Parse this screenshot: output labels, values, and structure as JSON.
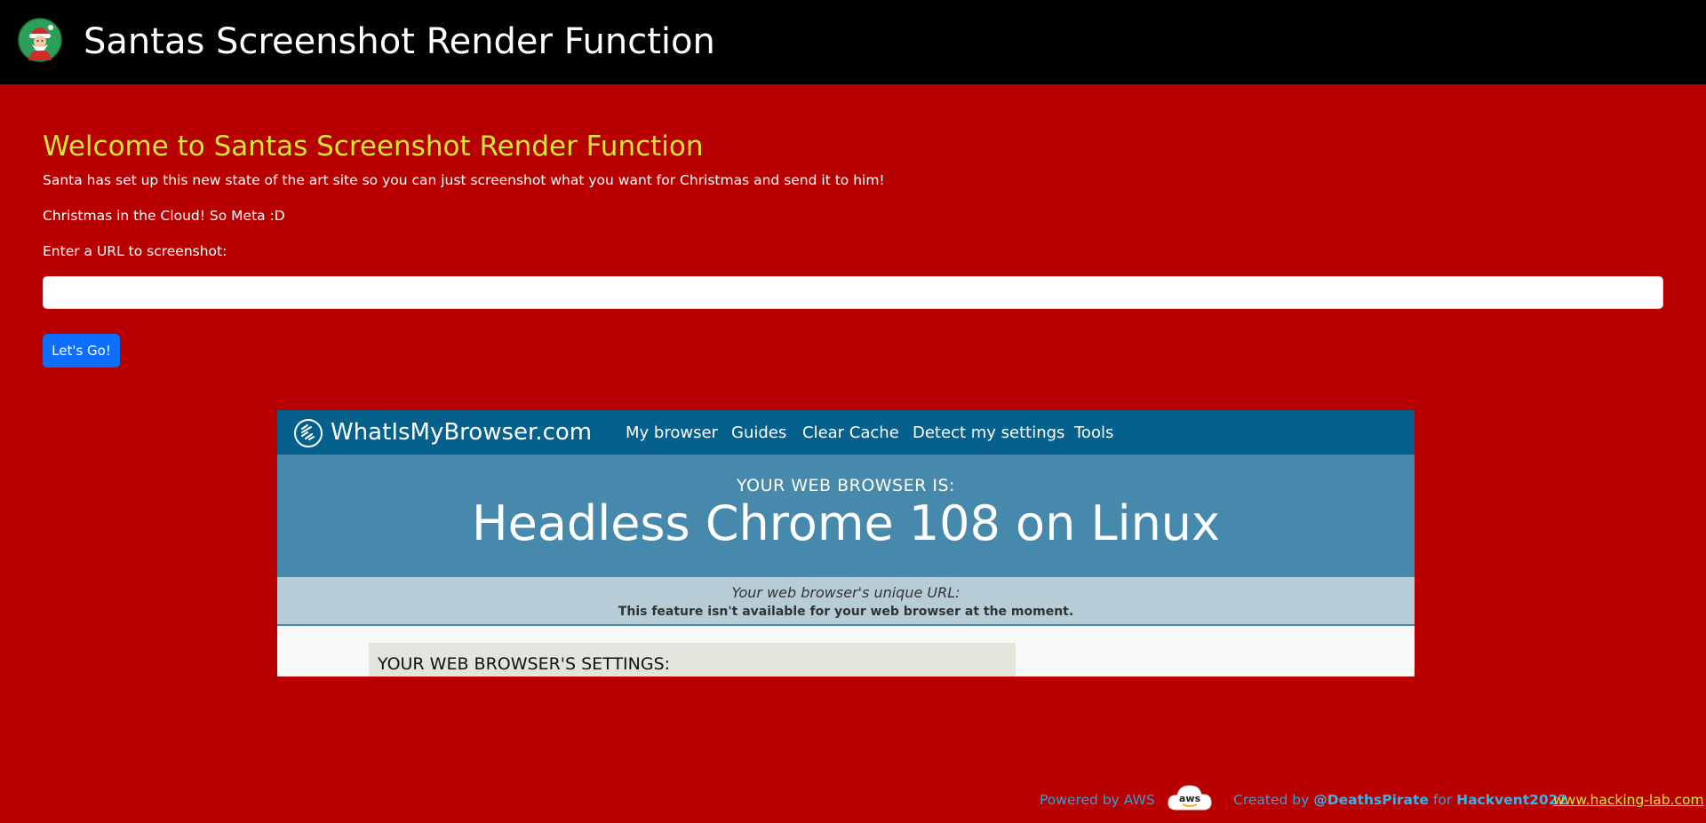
{
  "header": {
    "title": "Santas Screenshot Render Function",
    "logo_icon": "santa-avatar-icon"
  },
  "main": {
    "welcome": "Welcome to Santas Screenshot Render Function",
    "intro": "Santa has set up this new state of the art site so you can just screenshot what you want for Christmas and send it to him!",
    "tagline": "Christmas in the Cloud! So Meta :D",
    "url_prompt": "Enter a URL to screenshot:",
    "url_value": "",
    "submit_label": "Let's Go!"
  },
  "screenshot": {
    "brand": "WhatIsMyBrowser.com",
    "menu": [
      "My browser",
      "Guides",
      "Clear Cache",
      "Detect my settings",
      "Tools"
    ],
    "hero_label": "YOUR WEB BROWSER IS:",
    "hero_value": "Headless Chrome 108 on Linux",
    "url_label": "Your web browser's unique URL:",
    "url_note": "This feature isn't available for your web browser at the moment.",
    "settings_title": "YOUR WEB BROWSER'S SETTINGS:"
  },
  "footer": {
    "powered": "Powered by AWS",
    "aws_badge": "aws",
    "created_prefix": "Created by",
    "author": "@DeathsPirate",
    "for_word": "for",
    "event": "Hackvent2022",
    "link": "www.hacking-lab.com"
  },
  "colors": {
    "page_bg": "#b80000",
    "topbar_bg": "#000000",
    "accent_yellow": "#d4e53a",
    "button_blue": "#0d6efd",
    "footer_blue": "#3a9cd2",
    "shot_nav": "#06608c",
    "shot_hero": "#4689ad"
  }
}
